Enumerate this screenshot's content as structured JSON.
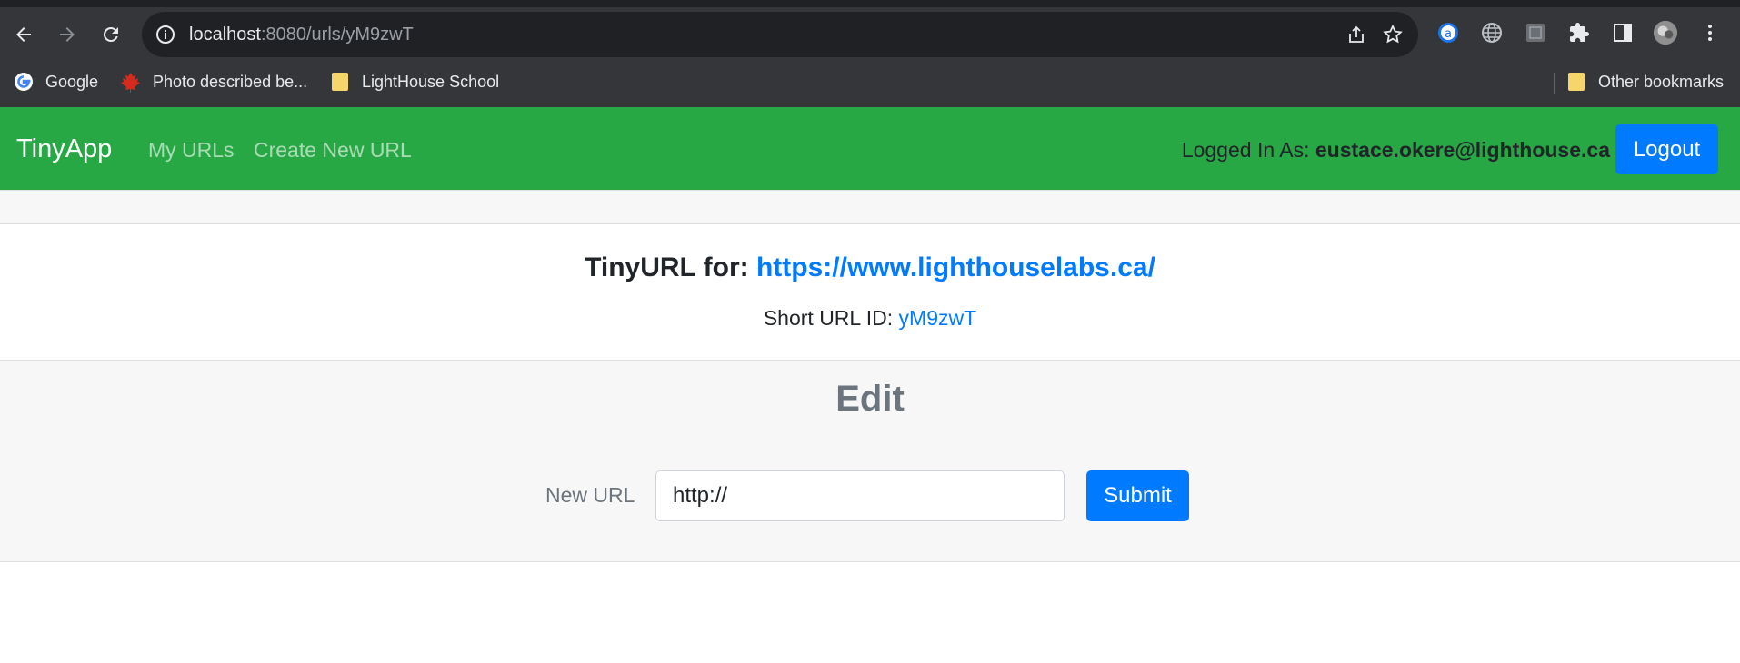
{
  "browser": {
    "url_host": "localhost",
    "url_path": ":8080/urls/yM9zwT",
    "bookmarks": [
      {
        "label": "Google"
      },
      {
        "label": "Photo described be..."
      },
      {
        "label": "LightHouse School"
      }
    ],
    "other_bookmarks": "Other bookmarks"
  },
  "navbar": {
    "brand": "TinyApp",
    "links": [
      "My URLs",
      "Create New URL"
    ],
    "logged_in_prefix": "Logged In As: ",
    "logged_in_email": "eustace.okere@lighthouse.ca",
    "logout_label": "Logout"
  },
  "card": {
    "title_prefix": "TinyURL for: ",
    "long_url": "https://www.lighthouselabs.ca/",
    "short_id_prefix": "Short URL ID: ",
    "short_id": "yM9zwT"
  },
  "edit": {
    "heading": "Edit",
    "label": "New URL",
    "input_value": "http://",
    "submit_label": "Submit"
  },
  "colors": {
    "navbar": "#28a745",
    "primary": "#007bff",
    "chrome": "#35363a"
  }
}
